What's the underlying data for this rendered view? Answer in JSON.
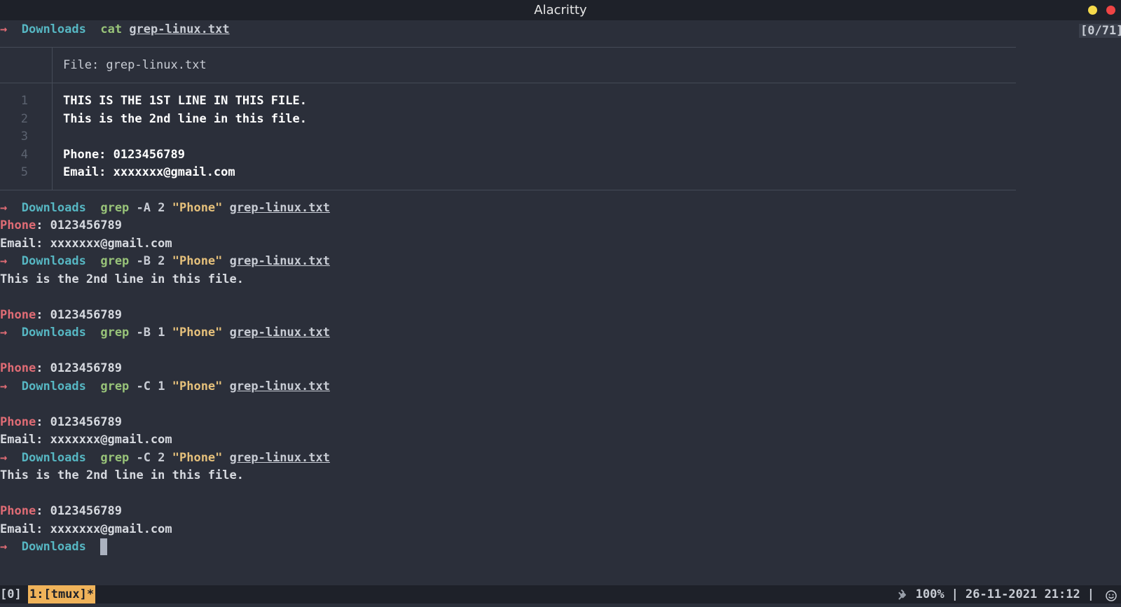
{
  "window": {
    "title": "Alacritty"
  },
  "counter": "[0/71]",
  "prompt": {
    "arrow": "→",
    "dir": "Downloads"
  },
  "cmd_cat": {
    "cmd": "cat",
    "file": "grep-linux.txt"
  },
  "bat": {
    "header": "File: grep-linux.txt",
    "lines": [
      {
        "n": "1",
        "text": "THIS IS THE 1ST LINE IN THIS FILE."
      },
      {
        "n": "2",
        "text": "This is the 2nd line in this file."
      },
      {
        "n": "3",
        "text": ""
      },
      {
        "n": "4",
        "text": "Phone: 0123456789"
      },
      {
        "n": "5",
        "text": "Email: xxxxxxx@gmail.com"
      }
    ]
  },
  "grep1": {
    "cmd": "grep",
    "flag": "-A 2",
    "pattern": "\"Phone\"",
    "file": "grep-linux.txt"
  },
  "grep2": {
    "cmd": "grep",
    "flag": "-B 2",
    "pattern": "\"Phone\"",
    "file": "grep-linux.txt"
  },
  "grep3": {
    "cmd": "grep",
    "flag": "-B 1",
    "pattern": "\"Phone\"",
    "file": "grep-linux.txt"
  },
  "grep4": {
    "cmd": "grep",
    "flag": "-C 1",
    "pattern": "\"Phone\"",
    "file": "grep-linux.txt"
  },
  "grep5": {
    "cmd": "grep",
    "flag": "-C 2",
    "pattern": "\"Phone\"",
    "file": "grep-linux.txt"
  },
  "out": {
    "phone_label": "Phone",
    "phone_rest": ": 0123456789",
    "email": "Email: xxxxxxx@gmail.com",
    "second": "This is the 2nd line in this file."
  },
  "status": {
    "session": "[0]",
    "window": "1:[tmux]*",
    "battery": "100%",
    "sep": "|",
    "datetime": "26-11-2021 21:12",
    "plug_icon": "plug-icon",
    "smile_icon": "smiley-icon"
  },
  "colors": {
    "background": "#2b2f3a",
    "prompt_arrow": "#e06c75",
    "prompt_dir": "#56b6c2",
    "command": "#98c379",
    "string": "#e5c07b",
    "match": "#e06c75",
    "tmux_active": "#f0b35a"
  }
}
